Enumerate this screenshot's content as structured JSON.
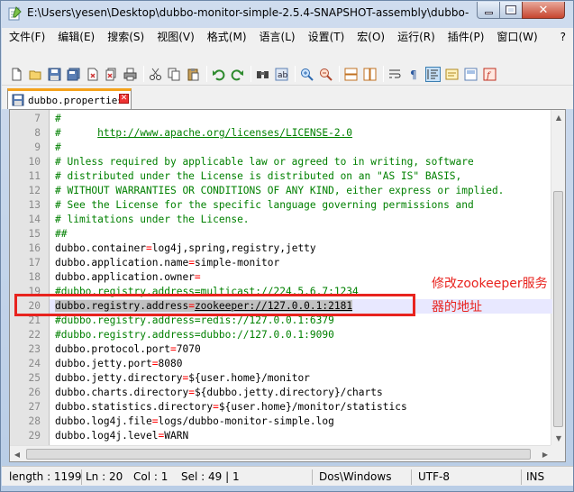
{
  "window": {
    "title": "E:\\Users\\yesen\\Desktop\\dubbo-monitor-simple-2.5.4-SNAPSHOT-assembly\\dubbo-..."
  },
  "menu": {
    "items": [
      "文件(F)",
      "编辑(E)",
      "搜索(S)",
      "视图(V)",
      "格式(M)",
      "语言(L)",
      "设置(T)",
      "宏(O)",
      "运行(R)",
      "插件(P)",
      "窗口(W)"
    ],
    "help": "?"
  },
  "tab": {
    "label": "dubbo.properties"
  },
  "editor": {
    "lines": [
      {
        "n": "7",
        "parts": [
          {
            "t": "#",
            "c": "comment"
          }
        ]
      },
      {
        "n": "8",
        "parts": [
          {
            "t": "#      ",
            "c": "comment"
          },
          {
            "t": "http://www.apache.org/licenses/LICENSE-2.0",
            "c": "url"
          }
        ]
      },
      {
        "n": "9",
        "parts": [
          {
            "t": "#",
            "c": "comment"
          }
        ]
      },
      {
        "n": "10",
        "parts": [
          {
            "t": "# Unless required by applicable law or agreed to in writing, software",
            "c": "comment"
          }
        ]
      },
      {
        "n": "11",
        "parts": [
          {
            "t": "# distributed under the License is distributed on an \"AS IS\" BASIS,",
            "c": "comment"
          }
        ]
      },
      {
        "n": "12",
        "parts": [
          {
            "t": "# WITHOUT WARRANTIES OR CONDITIONS OF ANY KIND, either express or implied.",
            "c": "comment"
          }
        ]
      },
      {
        "n": "13",
        "parts": [
          {
            "t": "# See the License for the specific language governing permissions and",
            "c": "comment"
          }
        ]
      },
      {
        "n": "14",
        "parts": [
          {
            "t": "# limitations under the License.",
            "c": "comment"
          }
        ]
      },
      {
        "n": "15",
        "parts": [
          {
            "t": "##",
            "c": "comment"
          }
        ]
      },
      {
        "n": "16",
        "parts": [
          {
            "t": "dubbo.container",
            "c": "key"
          },
          {
            "t": "=",
            "c": "eq"
          },
          {
            "t": "log4j,spring,registry,jetty",
            "c": "val"
          }
        ]
      },
      {
        "n": "17",
        "parts": [
          {
            "t": "dubbo.application.name",
            "c": "key"
          },
          {
            "t": "=",
            "c": "eq"
          },
          {
            "t": "simple-monitor",
            "c": "val"
          }
        ]
      },
      {
        "n": "18",
        "parts": [
          {
            "t": "dubbo.application.owner",
            "c": "key"
          },
          {
            "t": "=",
            "c": "eq"
          }
        ]
      },
      {
        "n": "19",
        "parts": [
          {
            "t": "#dubbo.registry.address=multicast://224.5.6.7:1234",
            "c": "comment"
          }
        ]
      },
      {
        "n": "20",
        "highlight": true,
        "parts": [
          {
            "t": "dubbo.registry.address",
            "c": "key sel"
          },
          {
            "t": "=",
            "c": "eq sel"
          },
          {
            "t": "zookeeper://127.0.0.1:2181",
            "c": "val sel uline"
          }
        ]
      },
      {
        "n": "21",
        "parts": [
          {
            "t": "#dubbo.registry.address=redis://127.0.0.1:6379",
            "c": "comment"
          }
        ]
      },
      {
        "n": "22",
        "parts": [
          {
            "t": "#dubbo.registry.address=dubbo://127.0.0.1:9090",
            "c": "comment"
          }
        ]
      },
      {
        "n": "23",
        "parts": [
          {
            "t": "dubbo.protocol.port",
            "c": "key"
          },
          {
            "t": "=",
            "c": "eq"
          },
          {
            "t": "7070",
            "c": "val"
          }
        ]
      },
      {
        "n": "24",
        "parts": [
          {
            "t": "dubbo.jetty.port",
            "c": "key"
          },
          {
            "t": "=",
            "c": "eq"
          },
          {
            "t": "8080",
            "c": "val"
          }
        ]
      },
      {
        "n": "25",
        "parts": [
          {
            "t": "dubbo.jetty.directory",
            "c": "key"
          },
          {
            "t": "=",
            "c": "eq"
          },
          {
            "t": "${user.home}/monitor",
            "c": "val"
          }
        ]
      },
      {
        "n": "26",
        "parts": [
          {
            "t": "dubbo.charts.directory",
            "c": "key"
          },
          {
            "t": "=",
            "c": "eq"
          },
          {
            "t": "${dubbo.jetty.directory}/charts",
            "c": "val"
          }
        ]
      },
      {
        "n": "27",
        "parts": [
          {
            "t": "dubbo.statistics.directory",
            "c": "key"
          },
          {
            "t": "=",
            "c": "eq"
          },
          {
            "t": "${user.home}/monitor/statistics",
            "c": "val"
          }
        ]
      },
      {
        "n": "28",
        "parts": [
          {
            "t": "dubbo.log4j.file",
            "c": "key"
          },
          {
            "t": "=",
            "c": "eq"
          },
          {
            "t": "logs/dubbo-monitor-simple.log",
            "c": "val"
          }
        ]
      },
      {
        "n": "29",
        "parts": [
          {
            "t": "dubbo.log4j.level",
            "c": "key"
          },
          {
            "t": "=",
            "c": "eq"
          },
          {
            "t": "WARN",
            "c": "val"
          }
        ]
      }
    ]
  },
  "annotation": {
    "line1": "修改zookeeper服务",
    "line2": "器的地址"
  },
  "status": {
    "length": "length : 1199",
    "ln": "Ln : 20",
    "col": "Col : 1",
    "sel": "Sel : 49 | 1",
    "eol": "Dos\\Windows",
    "encoding": "UTF-8",
    "mode": "INS"
  },
  "colors": {
    "comment": "#008000",
    "operator": "#ff0000",
    "annotation": "#e8231e",
    "tab_accent": "#f4a21c"
  }
}
